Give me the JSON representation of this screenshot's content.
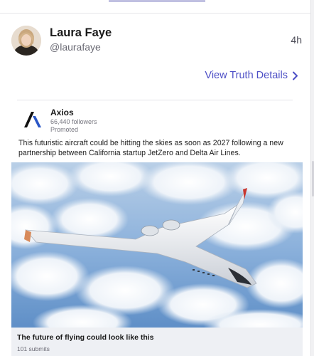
{
  "post": {
    "author_name": "Laura Faye",
    "author_handle": "@laurafaye",
    "time": "4h",
    "details_link": "View Truth Details"
  },
  "card": {
    "source_name": "Axios",
    "source_followers": "66,440 followers",
    "source_promoted": "Promoted",
    "text": "This futuristic aircraft could be hitting the skies as soon as 2027 following a new partnership between California startup JetZero and Delta Air Lines.",
    "caption_title": "The future of flying could look like this",
    "caption_sub": "101 submits"
  },
  "colors": {
    "accent": "#4d4fc6",
    "caption_bg": "#eef0f4",
    "sky": "#7ea9d8"
  },
  "icons": {
    "chevron": "chevron-right-icon",
    "logo": "axios-logo-icon"
  }
}
